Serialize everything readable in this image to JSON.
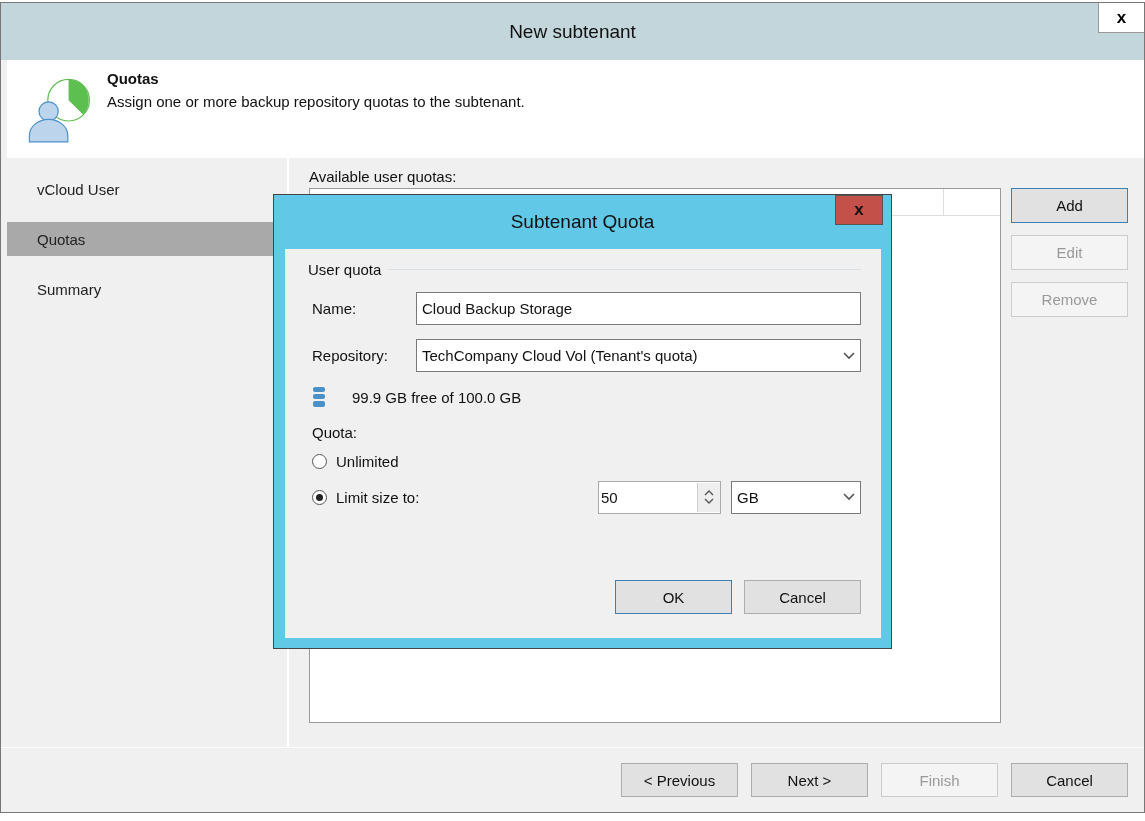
{
  "window": {
    "title": "New subtenant",
    "close": "x"
  },
  "header": {
    "title": "Quotas",
    "description": "Assign one or more backup repository quotas to the subtenant."
  },
  "steps": [
    {
      "label": "vCloud User",
      "selected": false
    },
    {
      "label": "Quotas",
      "selected": true
    },
    {
      "label": "Summary",
      "selected": false
    }
  ],
  "quotas_label": "Available user quotas:",
  "side_buttons": [
    {
      "label": "Add",
      "disabled": false
    },
    {
      "label": "Edit",
      "disabled": true
    },
    {
      "label": "Remove",
      "disabled": true
    }
  ],
  "footer_buttons": [
    {
      "label": "< Previous",
      "disabled": false
    },
    {
      "label": "Next >",
      "disabled": false
    },
    {
      "label": "Finish",
      "disabled": true
    },
    {
      "label": "Cancel",
      "disabled": false
    }
  ],
  "dialog": {
    "title": "Subtenant Quota",
    "close": "x",
    "group": "User quota",
    "name_label": "Name:",
    "name_value": "Cloud Backup Storage",
    "repository_label": "Repository:",
    "repository_value": "TechCompany Cloud Vol (Tenant's quota)",
    "free_space": "99.9 GB free of 100.0 GB",
    "quota_label": "Quota:",
    "options": [
      {
        "label": "Unlimited",
        "selected": false
      },
      {
        "label": "Limit size to:",
        "selected": true
      }
    ],
    "size_value": "50",
    "unit_value": "GB",
    "buttons": [
      {
        "label": "OK",
        "default": true
      },
      {
        "label": "Cancel",
        "default": false
      }
    ]
  }
}
